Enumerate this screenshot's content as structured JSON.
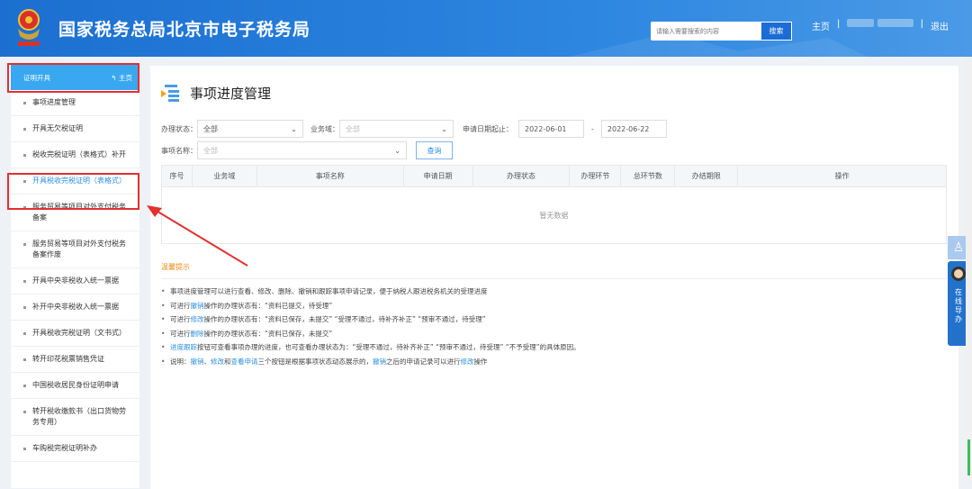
{
  "header": {
    "title": "国家税务总局北京市电子税务局",
    "search_placeholder": "请输入需要搜索的内容",
    "search_button": "搜索",
    "home": "主页",
    "logout": "退出"
  },
  "sidebar": {
    "header": "证明开具",
    "home": "主页",
    "items": [
      "事项进度管理",
      "开具无欠税证明",
      "税收完税证明（表格式）补开",
      "开具税收完税证明（表格式）",
      "服务贸易等项目对外支付税务备案",
      "服务贸易等项目对外支付税务备案作废",
      "开具中央非税收入统一票据",
      "补开中央非税收入统一票据",
      "开具税收完税证明（文书式）",
      "转开印花税票销售凭证",
      "中国税收居民身份证明申请",
      "转开税收缴款书（出口货物劳务专用）",
      "车购税完税证明补办"
    ],
    "active_index": 3
  },
  "main": {
    "title": "事项进度管理",
    "filters": {
      "status_label": "办理状态：",
      "status_value": "全部",
      "domain_label": "业务域：",
      "domain_placeholder": "全部",
      "date_label": "申请日期起止：",
      "date_from": "2022-06-01",
      "date_sep": "-",
      "date_to": "2022-06-22",
      "name_label": "事项名称：",
      "name_placeholder": "全部",
      "query_button": "查询"
    },
    "table": {
      "columns": [
        "序号",
        "业务域",
        "事项名称",
        "申请日期",
        "办理状态",
        "办理环节",
        "总环节数",
        "办结期限",
        "操作"
      ],
      "empty": "暂无数据"
    },
    "tips": {
      "title": "温馨提示",
      "items": [
        [
          {
            "t": "事项进度管理可以进行查看、修改、删除、撤销和跟踪事项申请记录，便于纳税人跟进税务机关的受理进度"
          }
        ],
        [
          {
            "t": "可进行"
          },
          {
            "t": "撤销",
            "l": 1
          },
          {
            "t": "操作的办理状态有：“资料已提交，待受理”"
          }
        ],
        [
          {
            "t": "可进行"
          },
          {
            "t": "修改",
            "l": 1
          },
          {
            "t": "操作的办理状态有：“资料已保存，未提交”  “受理不通过，待补齐补正”  “预审不通过，待受理”"
          }
        ],
        [
          {
            "t": "可进行"
          },
          {
            "t": "删除",
            "l": 1
          },
          {
            "t": "操作的办理状态有：“资料已保存，未提交”"
          }
        ],
        [
          {
            "t": "进度跟踪",
            "l": 1
          },
          {
            "t": "按钮可查看事项办理的进度，也可查看办理状态为：“受理不通过，待补齐补正”  “预审不通过，待受理”  “不予受理”的具体原因。"
          }
        ],
        [
          {
            "t": "说明："
          },
          {
            "t": "撤销",
            "l": 1
          },
          {
            "t": "、"
          },
          {
            "t": "修改",
            "l": 1
          },
          {
            "t": "和"
          },
          {
            "t": "查看申请",
            "l": 1
          },
          {
            "t": "三个按钮是根据事项状态动态展示的，"
          },
          {
            "t": "撤销",
            "l": 1
          },
          {
            "t": "之后的申请记录可以进行"
          },
          {
            "t": "修改",
            "l": 1
          },
          {
            "t": "操作"
          }
        ]
      ]
    }
  },
  "float": {
    "guide": "在线导办"
  }
}
